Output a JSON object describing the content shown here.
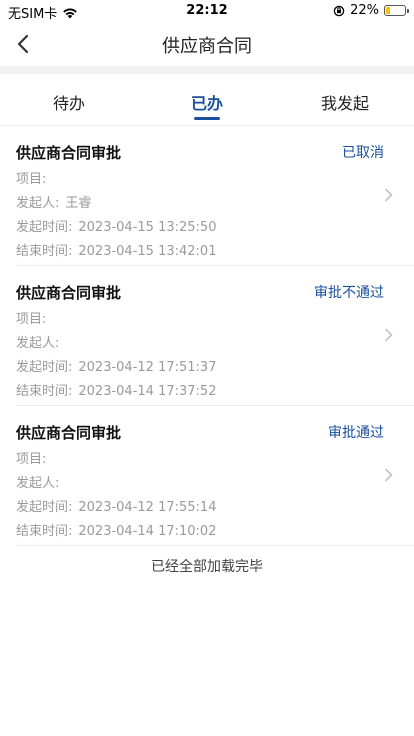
{
  "status_bar": {
    "carrier": "无SIM卡",
    "time": "22:12",
    "battery_percent": 22,
    "battery_label": "22%"
  },
  "header": {
    "title": "供应商合同"
  },
  "tabs": [
    {
      "label": "待办",
      "active": false
    },
    {
      "label": "已办",
      "active": true
    },
    {
      "label": "我发起",
      "active": false
    }
  ],
  "field_labels": {
    "project": "项目:",
    "initiator": "发起人:",
    "start_time": "发起时间:",
    "end_time": "结束时间:"
  },
  "items": [
    {
      "title": "供应商合同审批",
      "status": "已取消",
      "project": "",
      "initiator": "王睿",
      "start_time": "2023-04-15 13:25:50",
      "end_time": "2023-04-15 13:42:01"
    },
    {
      "title": "供应商合同审批",
      "status": "审批不通过",
      "project": "",
      "initiator": "",
      "start_time": "2023-04-12 17:51:37",
      "end_time": "2023-04-14 17:37:52"
    },
    {
      "title": "供应商合同审批",
      "status": "审批通过",
      "project": "",
      "initiator": "",
      "start_time": "2023-04-12 17:55:14",
      "end_time": "2023-04-14 17:10:02"
    }
  ],
  "footer": {
    "end_text": "已经全部加载完毕"
  },
  "colors": {
    "accent": "#1a4f9c",
    "muted_text": "#9a9a9a",
    "battery": "#f5c400"
  }
}
